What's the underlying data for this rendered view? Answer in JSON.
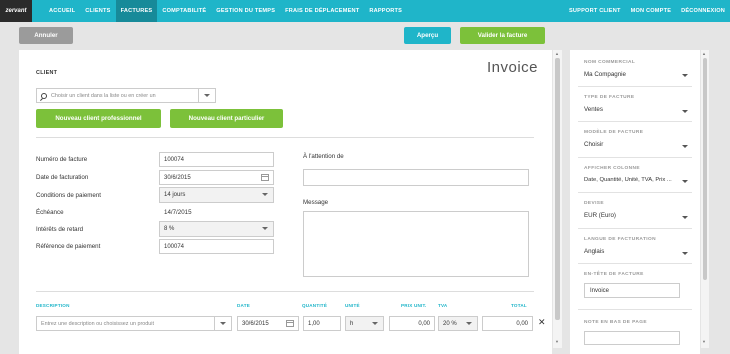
{
  "brand": {
    "logo_text": "zervant"
  },
  "nav": {
    "left": [
      {
        "label": "ACCUEIL",
        "active": false
      },
      {
        "label": "CLIENTS",
        "active": false
      },
      {
        "label": "FACTURES",
        "active": true
      },
      {
        "label": "COMPTABILITÉ",
        "active": false
      },
      {
        "label": "GESTION DU TEMPS",
        "active": false
      },
      {
        "label": "FRAIS DE DÉPLACEMENT",
        "active": false
      },
      {
        "label": "RAPPORTS",
        "active": false
      }
    ],
    "right": [
      {
        "label": "SUPPORT CLIENT"
      },
      {
        "label": "MON COMPTE"
      },
      {
        "label": "DÉCONNEXION"
      }
    ]
  },
  "actions": {
    "cancel": "Annuler",
    "preview": "Aperçu",
    "validate": "Valider la facture"
  },
  "invoice": {
    "title": "Invoice",
    "client_section": "CLIENT",
    "client_search_placeholder": "Choisir un client dans la liste ou en créer un",
    "new_pro_client": "Nouveau client professionnel",
    "new_private_client": "Nouveau client particulier",
    "fields": {
      "number_label": "Numéro de facture",
      "number_value": "100074",
      "date_label": "Date de facturation",
      "date_value": "30/6/2015",
      "terms_label": "Conditions de paiement",
      "terms_value": "14 jours",
      "due_label": "Échéance",
      "due_value": "14/7/2015",
      "late_label": "Intérêts de retard",
      "late_value": "8 %",
      "ref_label": "Référence de paiement",
      "ref_value": "100074"
    },
    "attention_label": "À l'attention de",
    "message_label": "Message",
    "lines": {
      "headers": {
        "description": "DESCRIPTION",
        "date": "DATE",
        "quantity": "QUANTITÉ",
        "unit": "UNITÉ",
        "unit_price": "PRIX UNIT.",
        "vat": "TVA",
        "total": "TOTAL"
      },
      "row": {
        "description_placeholder": "Entrez une description ou choisissez un produit",
        "date": "30/6/2015",
        "quantity": "1,00",
        "unit": "h",
        "unit_price": "0,00",
        "vat": "20 %",
        "total": "0,00"
      }
    }
  },
  "sidebar": {
    "trade_name_label": "NOM COMMERCIAL",
    "trade_name_value": "Ma Compagnie",
    "invoice_type_label": "TYPE DE FACTURE",
    "invoice_type_value": "Ventes",
    "template_label": "MODÈLE DE FACTURE",
    "template_value": "Choisir",
    "columns_label": "AFFICHER COLONNE",
    "columns_value": "Date, Quantité, Unité, TVA, Prix ...",
    "currency_label": "DEVISE",
    "currency_value": "EUR (Euro)",
    "language_label": "LANGUE DE FACTURATION",
    "language_value": "Anglais",
    "header_label": "EN-TÊTE DE FACTURE",
    "header_value": "Invoice",
    "footer_label": "NOTE EN BAS DE PAGE"
  },
  "colors": {
    "nav_bg": "#1fb5c9",
    "nav_active": "#178a99",
    "green": "#7cc13a",
    "cancel_gray": "#9b9b9b"
  }
}
